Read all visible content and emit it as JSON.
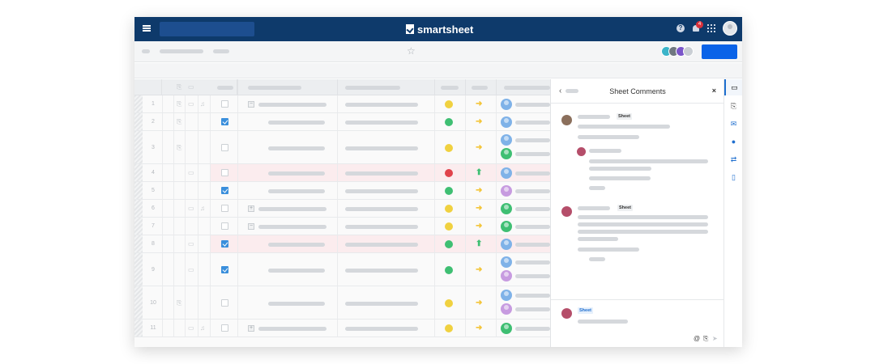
{
  "app": {
    "logo_text": "smartsheet"
  },
  "topbar": {
    "notification_count": "4"
  },
  "toolbar": {
    "star_glyph": "☆"
  },
  "grid": {
    "rows": [
      {
        "num": "1",
        "checked": false,
        "status": "yellow",
        "arrow": "right",
        "people": [
          "blue"
        ],
        "highlight": false,
        "expander": "−",
        "attach": true,
        "comment": true,
        "reminder": true
      },
      {
        "num": "2",
        "checked": true,
        "status": "green",
        "arrow": "right",
        "people": [
          "blue"
        ],
        "highlight": false,
        "expander": "",
        "attach": true,
        "comment": false,
        "reminder": false
      },
      {
        "num": "3",
        "checked": false,
        "status": "yellow",
        "arrow": "right",
        "people": [
          "blue",
          "green"
        ],
        "highlight": false,
        "expander": "",
        "attach": true,
        "comment": false,
        "reminder": false
      },
      {
        "num": "4",
        "checked": false,
        "status": "red",
        "arrow": "up",
        "people": [
          "blue"
        ],
        "highlight": true,
        "expander": "",
        "attach": false,
        "comment": true,
        "reminder": false
      },
      {
        "num": "5",
        "checked": true,
        "status": "green",
        "arrow": "right",
        "people": [
          "purple"
        ],
        "highlight": false,
        "expander": "",
        "attach": false,
        "comment": false,
        "reminder": false
      },
      {
        "num": "6",
        "checked": false,
        "status": "yellow",
        "arrow": "right",
        "people": [
          "green"
        ],
        "highlight": false,
        "expander": "+",
        "attach": false,
        "comment": true,
        "reminder": true
      },
      {
        "num": "7",
        "checked": false,
        "status": "yellow",
        "arrow": "right",
        "people": [
          "green"
        ],
        "highlight": false,
        "expander": "−",
        "attach": false,
        "comment": false,
        "reminder": false
      },
      {
        "num": "8",
        "checked": true,
        "status": "green",
        "arrow": "up",
        "people": [
          "blue"
        ],
        "highlight": true,
        "expander": "",
        "attach": false,
        "comment": true,
        "reminder": false
      },
      {
        "num": "9",
        "checked": true,
        "status": "green",
        "arrow": "right",
        "people": [
          "blue",
          "purple"
        ],
        "highlight": false,
        "expander": "",
        "attach": false,
        "comment": true,
        "reminder": false
      },
      {
        "num": "10",
        "checked": false,
        "status": "yellow",
        "arrow": "right",
        "people": [
          "blue",
          "purple"
        ],
        "highlight": false,
        "expander": "",
        "attach": true,
        "comment": false,
        "reminder": false
      },
      {
        "num": "11",
        "checked": false,
        "status": "yellow",
        "arrow": "right",
        "people": [
          "green"
        ],
        "highlight": false,
        "expander": "+",
        "attach": false,
        "comment": true,
        "reminder": true
      }
    ]
  },
  "colors": {
    "yellow": "#f0d140",
    "green": "#3fbf73",
    "red": "#e0434b",
    "blue": "#7fb2e8",
    "purple": "#c79be0",
    "arrow_right": "#f3c53a",
    "arrow_up": "#3fbf73"
  },
  "comments_panel": {
    "title": "Sheet Comments",
    "back_glyph": "‹",
    "close_glyph": "×",
    "thread_1_tag": "Sheet",
    "thread_2_tag": "Sheet",
    "composer_tag": "Sheet"
  },
  "icons": {
    "mention": "@",
    "attach": "⌕",
    "send": "➤"
  }
}
